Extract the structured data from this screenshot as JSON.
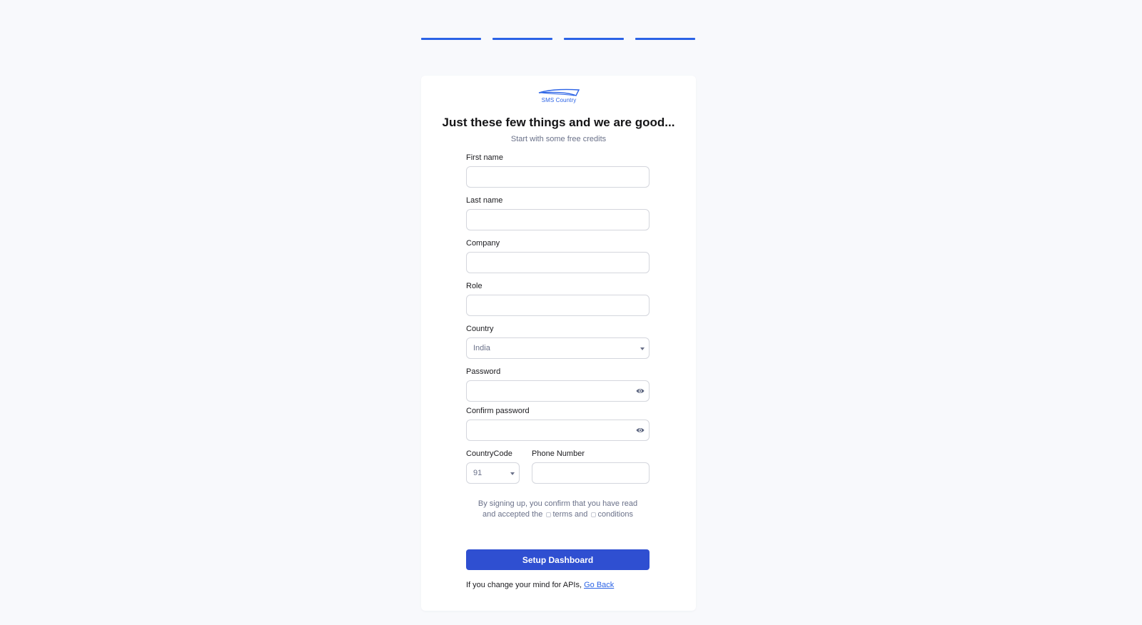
{
  "theme": {
    "accent": "#2b63e6",
    "button": "#2f4fd1",
    "background": "#f8f9fc"
  },
  "progress": {
    "total_steps": 4,
    "completed_steps": 4,
    "active_color": "#2b63e6"
  },
  "brand": {
    "logo_text": "SMS Country",
    "logo_icon": "boat-swoosh-logo"
  },
  "header": {
    "title": "Just these few things and we are good...",
    "subtitle": "Start with some free credits"
  },
  "form": {
    "first_name": {
      "label": "First name",
      "value": ""
    },
    "last_name": {
      "label": "Last name",
      "value": ""
    },
    "company": {
      "label": "Company",
      "value": ""
    },
    "role": {
      "label": "Role",
      "value": ""
    },
    "country": {
      "label": "Country",
      "value": "India"
    },
    "password": {
      "label": "Password",
      "value": "",
      "icon": "eye-icon"
    },
    "confirm_password": {
      "label": "Confirm password",
      "value": "",
      "icon": "eye-icon"
    },
    "country_code": {
      "label": "CountryCode",
      "value": "91"
    },
    "phone": {
      "label": "Phone Number",
      "value": ""
    }
  },
  "terms": {
    "line1": "By signing up, you confirm that you have read",
    "line2_a": "and accepted the",
    "line2_b": "terms and",
    "line2_c": "conditions"
  },
  "submit": {
    "label": "Setup Dashboard"
  },
  "footer": {
    "text": "If you change your mind for APIs,",
    "link_label": "Go Back"
  }
}
